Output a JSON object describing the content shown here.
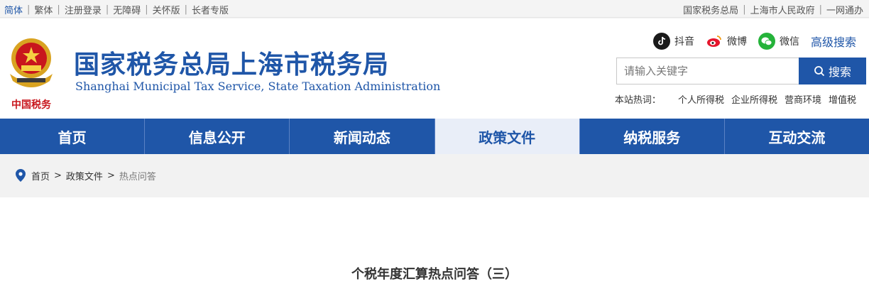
{
  "topbar": {
    "left": [
      "简体",
      "繁体",
      "注册登录",
      "无障碍",
      "关怀版",
      "长者专版"
    ],
    "right": [
      "国家税务总局",
      "上海市人民政府",
      "一网通办"
    ]
  },
  "header": {
    "title": "国家税务总局上海市税务局",
    "subtitle": "Shanghai Municipal Tax Service, State Taxation Administration",
    "emblem_caption": "中国税务"
  },
  "social": {
    "douyin": "抖音",
    "weibo": "微博",
    "wechat": "微信",
    "advanced_search": "高级搜索"
  },
  "search": {
    "placeholder": "请输入关键字",
    "button": "搜索"
  },
  "hotwords": {
    "label": "本站热词：",
    "items": [
      "个人所得税",
      "企业所得税",
      "营商环境",
      "增值税"
    ]
  },
  "nav": {
    "tabs": [
      "首页",
      "信息公开",
      "新闻动态",
      "政策文件",
      "纳税服务",
      "互动交流"
    ],
    "active_index": 3
  },
  "breadcrumb": {
    "items": [
      "首页",
      "政策文件",
      "热点问答"
    ]
  },
  "article": {
    "title": "个税年度汇算热点问答（三）"
  },
  "colors": {
    "brand": "#1f56a8",
    "emblem_red": "#c8161d",
    "emblem_gold": "#d9a321"
  }
}
